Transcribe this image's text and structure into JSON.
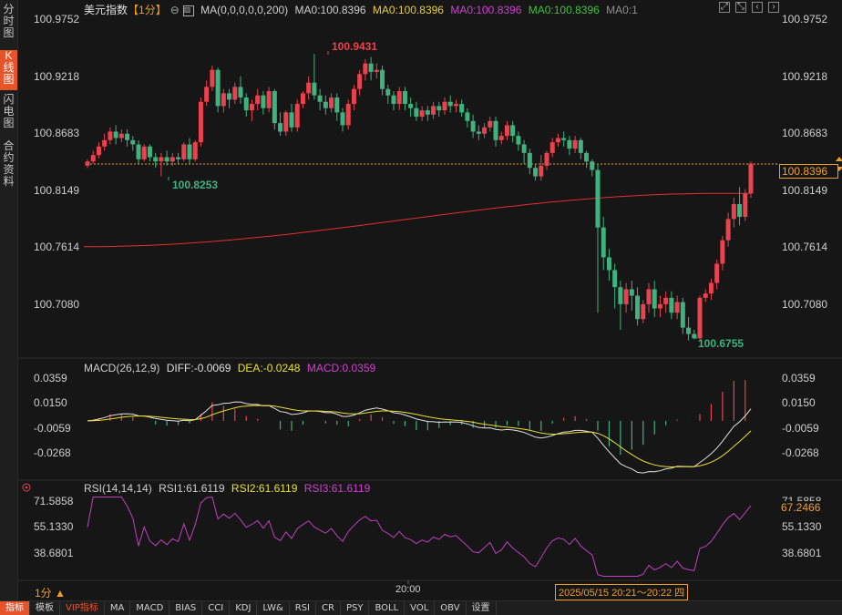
{
  "sidebar": {
    "tabs": [
      {
        "label": "分时图",
        "active": false
      },
      {
        "label": "K线图",
        "active": true
      },
      {
        "label": "闪电图",
        "active": false
      },
      {
        "label": "合约资料",
        "active": false
      }
    ]
  },
  "header": {
    "title": "美元指数",
    "period_badge": "【1分】",
    "ma_params": "MA(0,0,0,0,0,200)",
    "ma_values": [
      {
        "text": "MA0:100.8396",
        "color": "#d0d0d0"
      },
      {
        "text": "MA0:100.8396",
        "color": "#e8d030"
      },
      {
        "text": "MA0:100.8396",
        "color": "#d040d0"
      },
      {
        "text": "MA0:100.8396",
        "color": "#40c040"
      },
      {
        "text": "MA0:1",
        "color": "#909090"
      }
    ],
    "window_icons": [
      "expand-icon",
      "compress-icon",
      "prev-icon",
      "next-icon"
    ]
  },
  "price_panel": {
    "y_labels": [
      "100.9752",
      "100.9218",
      "100.8683",
      "100.8149",
      "100.7614",
      "100.7080"
    ],
    "current_price": "100.8396",
    "high_label": "100.9431",
    "low_label": "100.6755",
    "local_low_label": "100.8253"
  },
  "macd_panel": {
    "legend_name": "MACD(26,12,9)",
    "diff": "DIFF:-0.0069",
    "dea": "DEA:-0.0248",
    "macd": "MACD:0.0359",
    "y_labels": [
      "0.0359",
      "0.0150",
      "-0.0059",
      "-0.0268"
    ]
  },
  "rsi_panel": {
    "legend_name": "RSI(14,14,14)",
    "rsi1": "RSI1:61.6119",
    "rsi2": "RSI2:61.6119",
    "rsi3": "RSI3:61.6119",
    "y_labels": [
      "71.5858",
      "55.1330",
      "38.6801"
    ],
    "current": "67.2466"
  },
  "footer": {
    "period": "1分 ▲",
    "time_label": "20:00",
    "date_info": "2025/05/15 20:21～20:22 四"
  },
  "bottom_tabs": [
    "指标",
    "模板",
    "VIP指标",
    "MA",
    "MACD",
    "BIAS",
    "CCI",
    "KDJ",
    "LW&",
    "RSI",
    "CR",
    "PSY",
    "BOLL",
    "VOL",
    "OBV",
    "设置"
  ],
  "colors": {
    "up": "#e8434f",
    "down": "#3fb27f",
    "ma200": "#e03030",
    "diff": "#e0e0e0",
    "dea": "#e8e030",
    "rsi": "#c040c0",
    "accent": "#f0a020"
  },
  "chart_data": {
    "type": "candlestick",
    "candles": [
      [
        100.838,
        100.842,
        100.836,
        100.844
      ],
      [
        100.842,
        100.848,
        100.84,
        100.852
      ],
      [
        100.848,
        100.856,
        100.845,
        100.86
      ],
      [
        100.856,
        100.862,
        100.852,
        100.868
      ],
      [
        100.862,
        100.87,
        100.858,
        100.874
      ],
      [
        100.87,
        100.864,
        100.858,
        100.876
      ],
      [
        100.864,
        100.868,
        100.86,
        100.872
      ],
      [
        100.868,
        100.862,
        100.856,
        100.872
      ],
      [
        100.862,
        100.858,
        100.852,
        100.866
      ],
      [
        100.858,
        100.844,
        100.84,
        100.862
      ],
      [
        100.844,
        100.856,
        100.842,
        100.858
      ],
      [
        100.856,
        100.846,
        100.842,
        100.858
      ],
      [
        100.846,
        100.842,
        100.836,
        100.85
      ],
      [
        100.842,
        100.846,
        100.828,
        100.85
      ],
      [
        100.846,
        100.842,
        100.838,
        100.852
      ],
      [
        100.842,
        100.846,
        100.838,
        100.85
      ],
      [
        100.846,
        100.844,
        100.84,
        100.85
      ],
      [
        100.844,
        100.858,
        100.842,
        100.86
      ],
      [
        100.858,
        100.844,
        100.84,
        100.864
      ],
      [
        100.844,
        100.86,
        100.842,
        100.862
      ],
      [
        100.86,
        100.898,
        100.856,
        100.902
      ],
      [
        100.898,
        100.912,
        100.894,
        100.918
      ],
      [
        100.912,
        100.928,
        100.908,
        100.932
      ],
      [
        100.928,
        100.894,
        100.888,
        100.93
      ],
      [
        100.894,
        100.906,
        100.888,
        100.91
      ],
      [
        100.906,
        100.9,
        100.892,
        100.91
      ],
      [
        100.9,
        100.912,
        100.896,
        100.916
      ],
      [
        100.912,
        100.902,
        100.896,
        100.922
      ],
      [
        100.902,
        100.89,
        100.884,
        100.906
      ],
      [
        100.89,
        100.896,
        100.88,
        100.9
      ],
      [
        100.896,
        100.904,
        100.89,
        100.91
      ],
      [
        100.904,
        100.892,
        100.886,
        100.908
      ],
      [
        100.892,
        100.908,
        100.888,
        100.912
      ],
      [
        100.908,
        100.878,
        100.872,
        100.91
      ],
      [
        100.878,
        100.87,
        100.866,
        100.888
      ],
      [
        100.87,
        100.888,
        100.866,
        100.89
      ],
      [
        100.888,
        100.874,
        100.87,
        100.896
      ],
      [
        100.874,
        100.896,
        100.87,
        100.9
      ],
      [
        100.896,
        100.906,
        100.892,
        100.908
      ],
      [
        100.906,
        100.916,
        100.9,
        100.922
      ],
      [
        100.916,
        100.904,
        100.9,
        100.943
      ],
      [
        100.904,
        100.898,
        100.89,
        100.91
      ],
      [
        100.898,
        100.892,
        100.886,
        100.904
      ],
      [
        100.892,
        100.902,
        100.888,
        100.906
      ],
      [
        100.902,
        100.888,
        100.88,
        100.906
      ],
      [
        100.888,
        100.876,
        100.87,
        100.892
      ],
      [
        100.876,
        100.896,
        100.872,
        100.9
      ],
      [
        100.896,
        100.91,
        100.89,
        100.914
      ],
      [
        100.91,
        100.924,
        100.904,
        100.928
      ],
      [
        100.924,
        100.934,
        100.918,
        100.938
      ],
      [
        100.934,
        100.926,
        100.918,
        100.94
      ],
      [
        100.926,
        100.928,
        100.92,
        100.934
      ],
      [
        100.928,
        100.91,
        100.904,
        100.932
      ],
      [
        100.91,
        100.904,
        100.896,
        100.914
      ],
      [
        100.904,
        100.896,
        100.89,
        100.908
      ],
      [
        100.896,
        100.908,
        100.89,
        100.912
      ],
      [
        100.908,
        100.896,
        100.89,
        100.912
      ],
      [
        100.896,
        100.892,
        100.884,
        100.902
      ],
      [
        100.892,
        100.884,
        100.88,
        100.898
      ],
      [
        100.884,
        100.89,
        100.88,
        100.894
      ],
      [
        100.89,
        100.886,
        100.88,
        100.894
      ],
      [
        100.886,
        100.894,
        100.882,
        100.898
      ],
      [
        100.894,
        100.89,
        100.884,
        100.898
      ],
      [
        100.89,
        100.898,
        100.886,
        100.902
      ],
      [
        100.898,
        100.894,
        100.888,
        100.904
      ],
      [
        100.894,
        100.896,
        100.888,
        100.9
      ],
      [
        100.896,
        100.888,
        100.884,
        100.9
      ],
      [
        100.888,
        100.88,
        100.874,
        100.892
      ],
      [
        100.88,
        100.87,
        100.864,
        100.886
      ],
      [
        100.87,
        100.868,
        100.862,
        100.876
      ],
      [
        100.868,
        100.874,
        100.864,
        100.878
      ],
      [
        100.874,
        100.88,
        100.87,
        100.884
      ],
      [
        100.88,
        100.862,
        100.856,
        100.884
      ],
      [
        100.862,
        100.866,
        100.858,
        100.87
      ],
      [
        100.866,
        100.876,
        100.862,
        100.88
      ],
      [
        100.876,
        100.866,
        100.86,
        100.88
      ],
      [
        100.866,
        100.858,
        100.852,
        100.87
      ],
      [
        100.858,
        100.85,
        100.84,
        100.862
      ],
      [
        100.85,
        100.836,
        100.83,
        100.854
      ],
      [
        100.836,
        100.828,
        100.824,
        100.84
      ],
      [
        100.828,
        100.838,
        100.824,
        100.848
      ],
      [
        100.838,
        100.85,
        100.834,
        100.852
      ],
      [
        100.85,
        100.86,
        100.846,
        100.864
      ],
      [
        100.86,
        100.864,
        100.856,
        100.868
      ],
      [
        100.864,
        100.862,
        100.856,
        100.87
      ],
      [
        100.862,
        100.854,
        100.848,
        100.866
      ],
      [
        100.854,
        100.862,
        100.85,
        100.866
      ],
      [
        100.862,
        100.85,
        100.844,
        100.864
      ],
      [
        100.85,
        100.842,
        100.836,
        100.852
      ],
      [
        100.842,
        100.834,
        100.828,
        100.844
      ],
      [
        100.834,
        100.78,
        100.7,
        100.84
      ],
      [
        100.78,
        100.752,
        100.74,
        100.79
      ],
      [
        100.752,
        100.74,
        100.73,
        100.76
      ],
      [
        100.74,
        100.724,
        100.704,
        100.746
      ],
      [
        100.724,
        100.708,
        100.684,
        100.73
      ],
      [
        100.708,
        100.722,
        100.7,
        100.728
      ],
      [
        100.722,
        100.716,
        100.702,
        100.73
      ],
      [
        100.716,
        100.694,
        100.688,
        100.724
      ],
      [
        100.694,
        100.708,
        100.69,
        100.712
      ],
      [
        100.708,
        100.722,
        100.7,
        100.728
      ],
      [
        100.722,
        100.704,
        100.696,
        100.73
      ],
      [
        100.704,
        100.708,
        100.696,
        100.716
      ],
      [
        100.708,
        100.714,
        100.7,
        100.72
      ],
      [
        100.714,
        100.7,
        100.694,
        100.72
      ],
      [
        100.7,
        100.71,
        100.694,
        100.716
      ],
      [
        100.71,
        100.686,
        100.68,
        100.714
      ],
      [
        100.686,
        100.68,
        100.674,
        100.696
      ],
      [
        100.68,
        100.676,
        100.675,
        100.684
      ],
      [
        100.676,
        100.714,
        100.675,
        100.716
      ],
      [
        100.714,
        100.718,
        100.71,
        100.722
      ],
      [
        100.718,
        100.728,
        100.712,
        100.732
      ],
      [
        100.728,
        100.746,
        100.722,
        100.75
      ],
      [
        100.746,
        100.768,
        100.74,
        100.772
      ],
      [
        100.768,
        100.788,
        100.762,
        100.794
      ],
      [
        100.788,
        100.802,
        100.78,
        100.808
      ],
      [
        100.802,
        100.79,
        100.782,
        100.818
      ],
      [
        100.79,
        100.812,
        100.786,
        100.816
      ],
      [
        100.812,
        100.84,
        100.808,
        100.842
      ]
    ],
    "ma200": {
      "start": 100.762,
      "end": 100.812
    },
    "y_range": [
      100.66,
      100.985
    ],
    "dashed_level": 100.8396
  }
}
